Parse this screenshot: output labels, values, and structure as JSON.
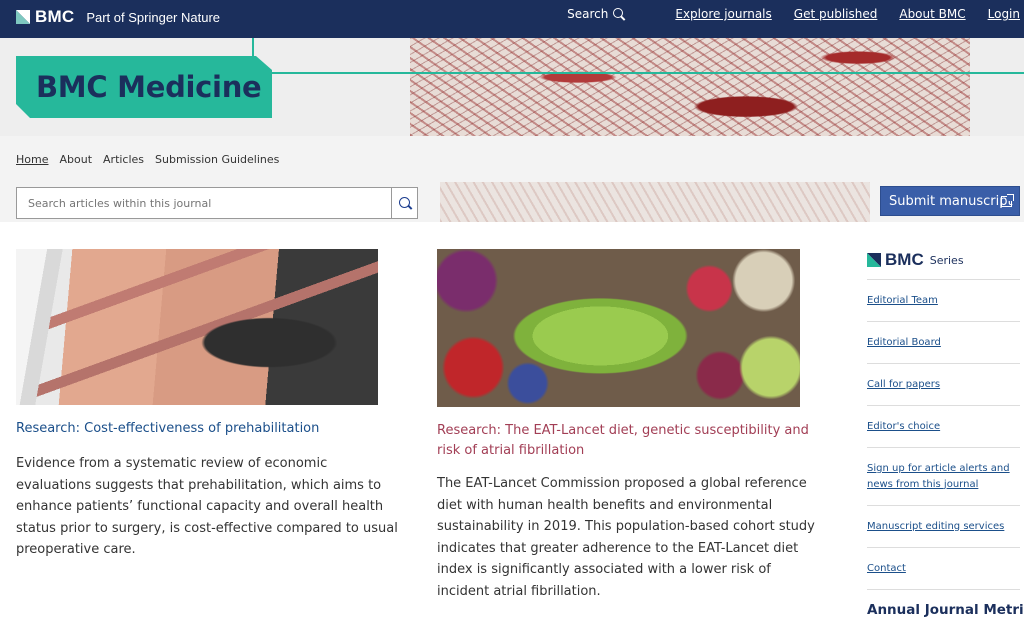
{
  "header": {
    "logo_text": "BMC",
    "logo_sub": "Part of Springer Nature",
    "search_label": "Search",
    "nav": [
      "Explore journals",
      "Get published",
      "About BMC",
      "Login"
    ]
  },
  "banner": {
    "journal_title": "BMC Medicine"
  },
  "subnav": {
    "items": [
      "Home",
      "About",
      "Articles",
      "Submission Guidelines"
    ]
  },
  "search": {
    "placeholder": "Search articles within this journal"
  },
  "submit": {
    "label": "Submit manuscript"
  },
  "articles": [
    {
      "headline": "Research: Cost-effectiveness of prehabilitation",
      "description": "Evidence from a systematic review of economic evaluations suggests that prehabilitation, which aims to enhance patients’ functional capacity and overall health status prior to surgery, is cost-effective compared to usual preoperative care."
    },
    {
      "headline": "Research: The EAT-Lancet diet, genetic susceptibility and risk of atrial fibrillation",
      "description": "The EAT-Lancet Commission proposed a global reference diet with human health benefits and environmental sustainability in 2019. This population-based cohort study indicates that greater adherence to the EAT-Lancet diet index is significantly associated with a lower risk of incident atrial fibrillation."
    }
  ],
  "sidebar": {
    "series_logo": "BMC",
    "series_label": "Series",
    "links": [
      "Editorial Team",
      "Editorial Board",
      "Call for papers",
      "Editor's choice",
      "Sign up for article alerts and news from this journal",
      "Manuscript editing services",
      "Contact"
    ],
    "metrics_heading": "Annual Journal Metrics"
  },
  "colors": {
    "header_bg": "#1b2f5c",
    "accent_teal": "#26b89b",
    "submit_bg": "#3a5ea8",
    "headline_blue": "#1b4f8a",
    "headline_red": "#a23e55"
  }
}
